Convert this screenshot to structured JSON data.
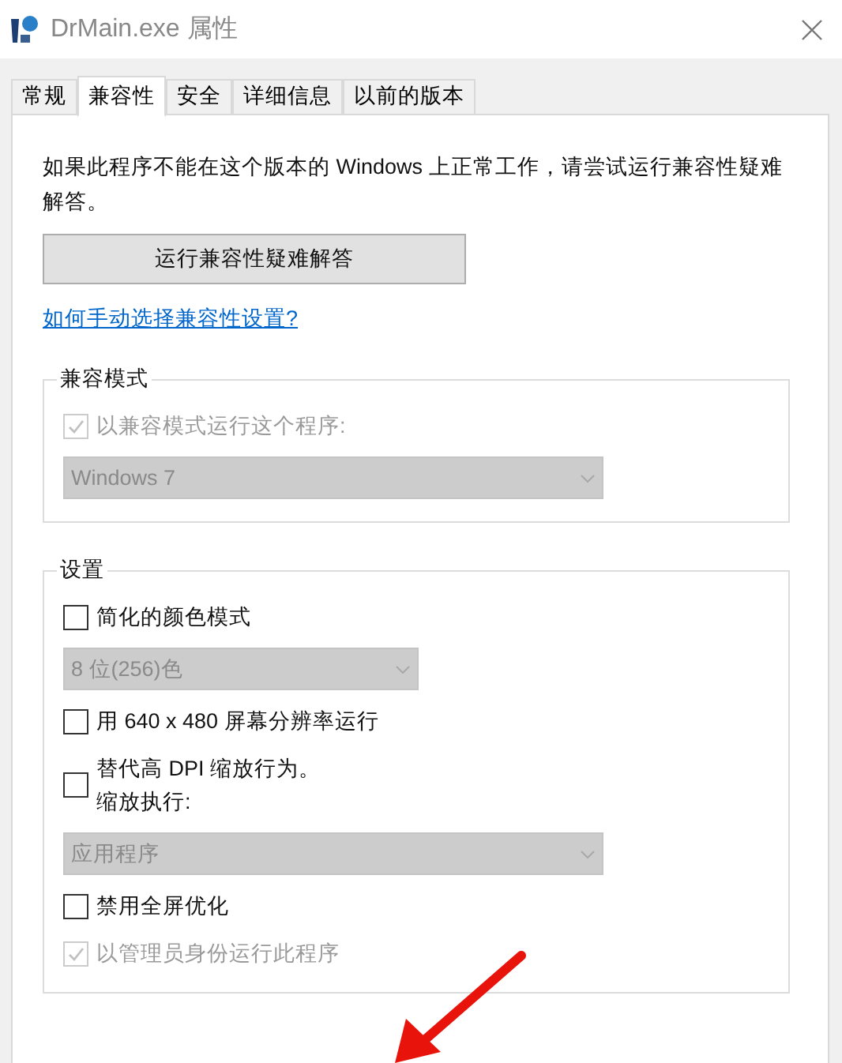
{
  "window": {
    "title": "DrMain.exe 属性"
  },
  "tabs": [
    {
      "label": "常规",
      "selected": false
    },
    {
      "label": "兼容性",
      "selected": true
    },
    {
      "label": "安全",
      "selected": false
    },
    {
      "label": "详细信息",
      "selected": false
    },
    {
      "label": "以前的版本",
      "selected": false
    }
  ],
  "intro": "如果此程序不能在这个版本的 Windows 上正常工作，请尝试运行兼容性疑难解答。",
  "troubleshoot_button": "运行兼容性疑难解答",
  "help_link": "如何手动选择兼容性设置?",
  "groups": [
    {
      "title": "兼容模式",
      "items": [
        {
          "kind": "checkbox",
          "label": "以兼容模式运行这个程序:",
          "checked": true,
          "disabled": true
        },
        {
          "kind": "dropdown",
          "value": "Windows 7",
          "disabled": true,
          "wide": true
        }
      ]
    },
    {
      "title": "设置",
      "items": [
        {
          "kind": "checkbox",
          "label": "简化的颜色模式",
          "checked": false,
          "disabled": false
        },
        {
          "kind": "dropdown",
          "value": "8 位(256)色",
          "disabled": true,
          "wide": false
        },
        {
          "kind": "checkbox",
          "label": "用 640 x 480 屏幕分辨率运行",
          "checked": false,
          "disabled": false
        },
        {
          "kind": "checkbox",
          "label": "替代高 DPI 缩放行为。",
          "sublabel": "缩放执行:",
          "checked": false,
          "disabled": false
        },
        {
          "kind": "dropdown",
          "value": "应用程序",
          "disabled": true,
          "wide": true
        },
        {
          "kind": "checkbox",
          "label": "禁用全屏优化",
          "checked": false,
          "disabled": false
        },
        {
          "kind": "checkbox",
          "label": "以管理员身份运行此程序",
          "checked": true,
          "disabled": true
        }
      ]
    }
  ]
}
